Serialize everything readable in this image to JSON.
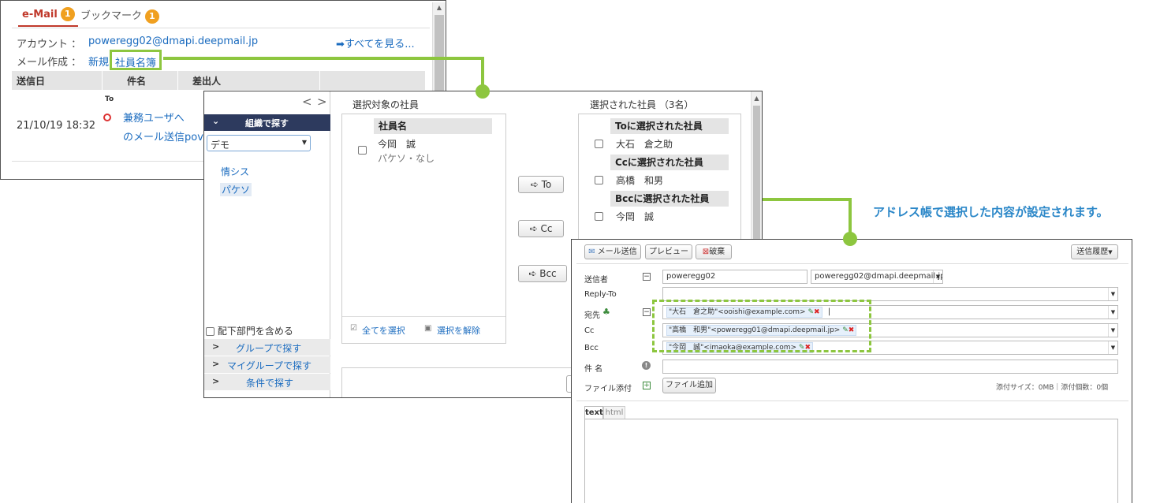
{
  "email_panel": {
    "tabs": [
      {
        "label": "e-Mail",
        "badge": "1"
      },
      {
        "label": "ブックマーク",
        "badge": "1"
      }
    ],
    "account_label": "アカウント ：",
    "account_value": "poweregg02@dmapi.deepmail.jp",
    "see_all": "➡すべてを見る...",
    "compose_label": "メール作成 ：",
    "compose_new": "新規",
    "compose_directory": "社員名簿",
    "columns": [
      "送信日",
      "件名",
      "差出人"
    ],
    "row": {
      "to_marker": "To",
      "date": "21/10/19 18:32",
      "subject_line1": "兼務ユーザへ",
      "subject_line2": "のメール送信pov"
    }
  },
  "directory_dialog": {
    "nav_prev": "<",
    "nav_next": ">",
    "org_search": "組織で探す",
    "org_select": "デモ",
    "depts": [
      "情シス",
      "パケソ"
    ],
    "include_sub": "配下部門を含める",
    "search_links": [
      "グループで探す",
      "マイグループで探す",
      "条件で探す"
    ],
    "target_title": "選択対象の社員",
    "target_header": "社員名",
    "target_employee": {
      "name": "今岡　誠",
      "dept": "パケソ・なし"
    },
    "select_all": "全てを選択",
    "deselect": "選択を解除",
    "move_buttons": [
      "To",
      "Cc",
      "Bcc"
    ],
    "selected_title": "選択された社員 （3名）",
    "selected_groups": [
      {
        "header": "Toに選択された社員",
        "name": "大石　倉之助"
      },
      {
        "header": "Ccに選択された社員",
        "name": "高橋　和男"
      },
      {
        "header": "Bccに選択された社員",
        "name": "今岡　誠"
      }
    ]
  },
  "callout": "アドレス帳で選択した内容が設定されます。",
  "compose_panel": {
    "toolbar": {
      "send": "メール送信",
      "preview": "プレビュー",
      "discard": "破棄",
      "history": "送信履歴"
    },
    "labels": {
      "sender": "送信者",
      "reply_to": "Reply-To",
      "to": "宛先",
      "cc": "Cc",
      "bcc": "Bcc",
      "subject": "件 名",
      "attach": "ファイル添付"
    },
    "sender_name": "poweregg02",
    "sender_address": "poweregg02@dmapi.deepmail.jp",
    "to_chip": "\"大石　倉之助\"<ooishi@example.com>",
    "cc_chip": "\"高橋　和男\"<poweregg01@dmapi.deepmail.jp>",
    "bcc_chip": "\"今岡　誠\"<imaoka@example.com>",
    "add_file": "ファイル追加",
    "attach_info": "添付サイズ：0MB｜添付個数：0個",
    "body_tabs": [
      "text",
      "html"
    ]
  }
}
